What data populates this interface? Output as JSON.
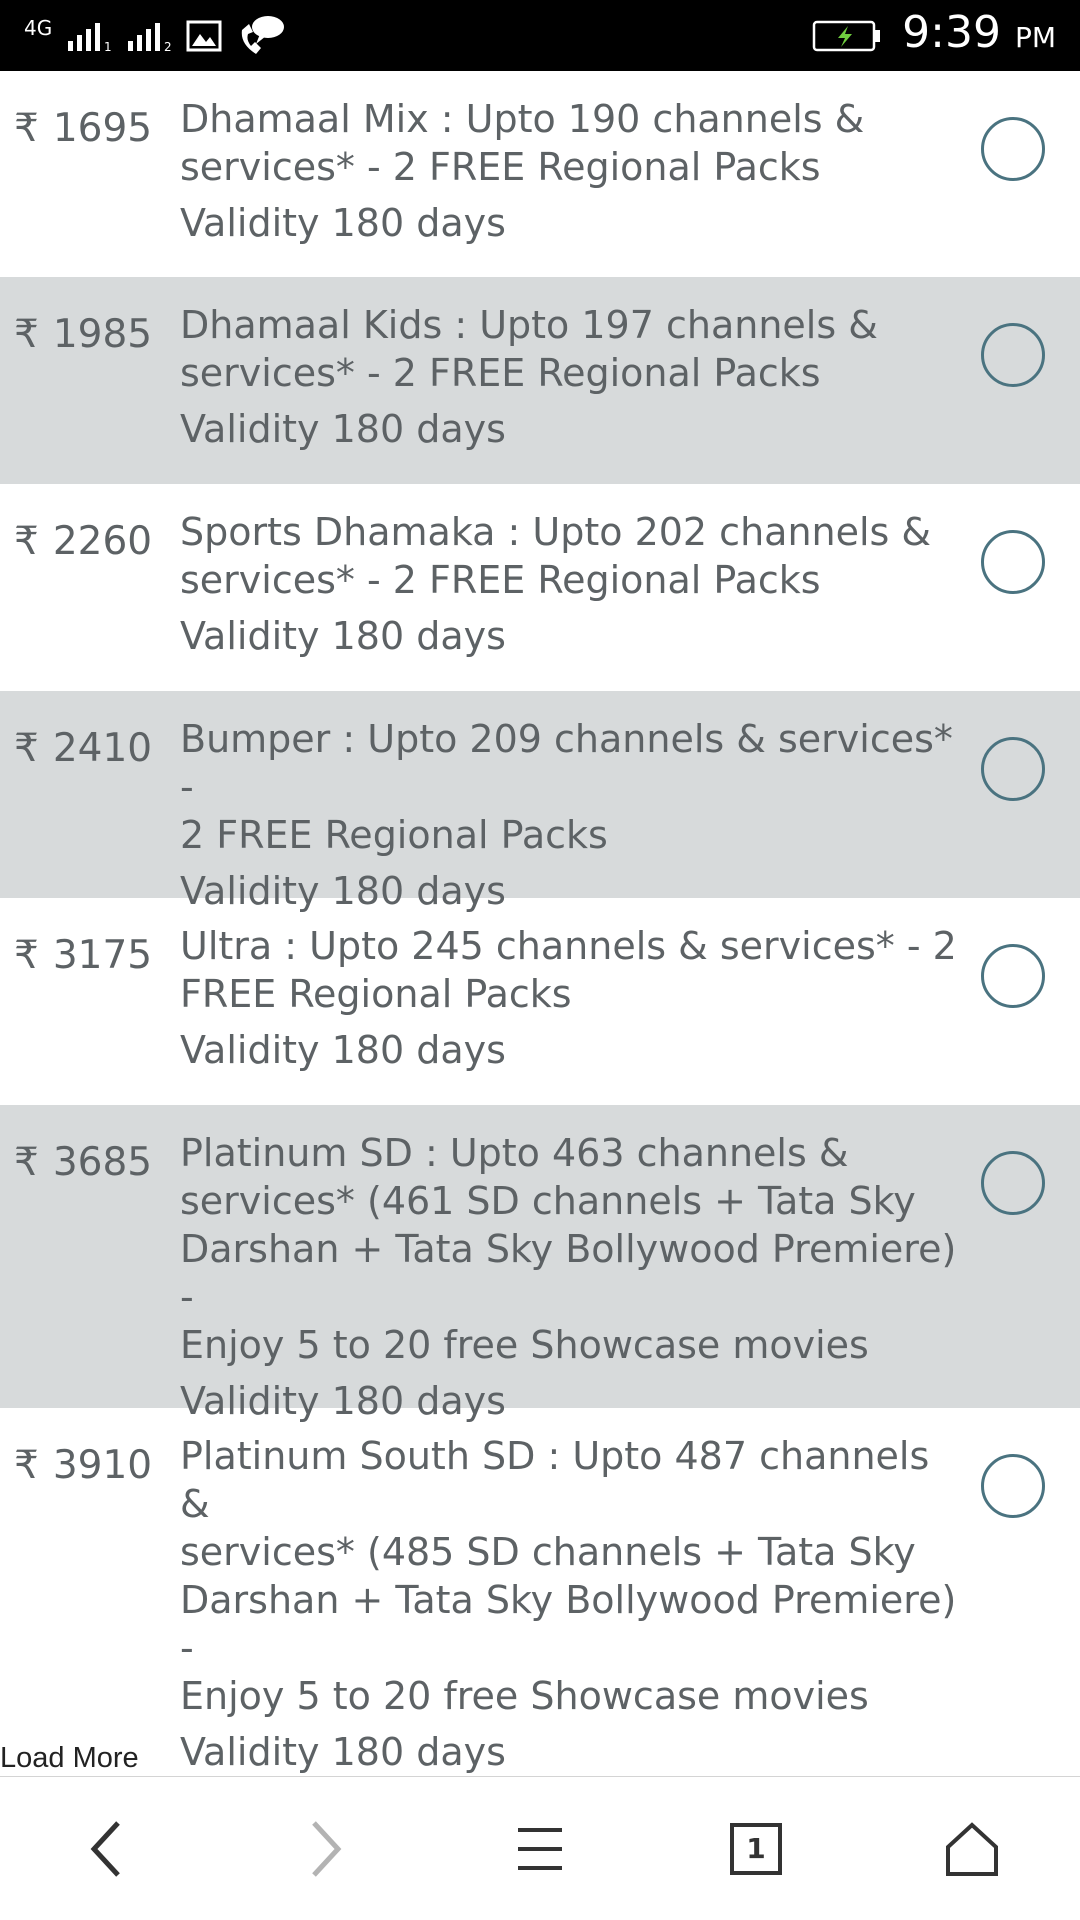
{
  "status_bar": {
    "network": "4G",
    "time": "9:39",
    "ampm": "PM",
    "icons": [
      "signal-sim1-icon",
      "signal-sim2-icon",
      "gallery-notification-icon",
      "voice-chat-notification-icon",
      "battery-charging-icon"
    ]
  },
  "currency_symbol": "₹",
  "packs": [
    {
      "price": "1695",
      "name": "Dhamaal Mix : Upto 190 channels &",
      "name2": "services* - 2 FREE Regional Packs",
      "validity": "Validity 180 days"
    },
    {
      "price": "1985",
      "name": "Dhamaal Kids : Upto 197 channels &",
      "name2": "services* - 2 FREE Regional Packs",
      "validity": "Validity 180 days"
    },
    {
      "price": "2260",
      "name": "Sports Dhamaka : Upto 202 channels &",
      "name2": "services* - 2 FREE Regional Packs",
      "validity": "Validity 180 days"
    },
    {
      "price": "2410",
      "name": "Bumper : Upto 209 channels & services* -",
      "name2": "2 FREE Regional Packs",
      "validity": "Validity 180 days"
    },
    {
      "price": "3175",
      "name": "Ultra : Upto 245 channels & services* - 2",
      "name2": "FREE Regional Packs",
      "validity": "Validity 180 days"
    },
    {
      "price": "3685",
      "name": "Platinum SD : Upto 463 channels &",
      "name2": "services* (461 SD channels + Tata Sky",
      "name3": "Darshan + Tata Sky Bollywood Premiere) -",
      "name4": "Enjoy 5 to 20 free Showcase movies",
      "validity": "Validity 180 days"
    },
    {
      "price": "3910",
      "name": "Platinum South SD : Upto 487 channels &",
      "name2": "services* (485 SD channels + Tata Sky",
      "name3": "Darshan + Tata Sky Bollywood Premiere) -",
      "name4": "Enjoy 5 to 20 free Showcase movies",
      "validity": "Validity 180 days"
    }
  ],
  "load_more": "Load More",
  "bottom_nav": [
    "back-icon",
    "forward-icon",
    "menu-icon",
    "tabs-icon",
    "home-icon"
  ],
  "tab_count": "1",
  "colors": {
    "row_shaded": "#d7dadb",
    "text": "#5d6265",
    "radio": "#4a7380"
  }
}
